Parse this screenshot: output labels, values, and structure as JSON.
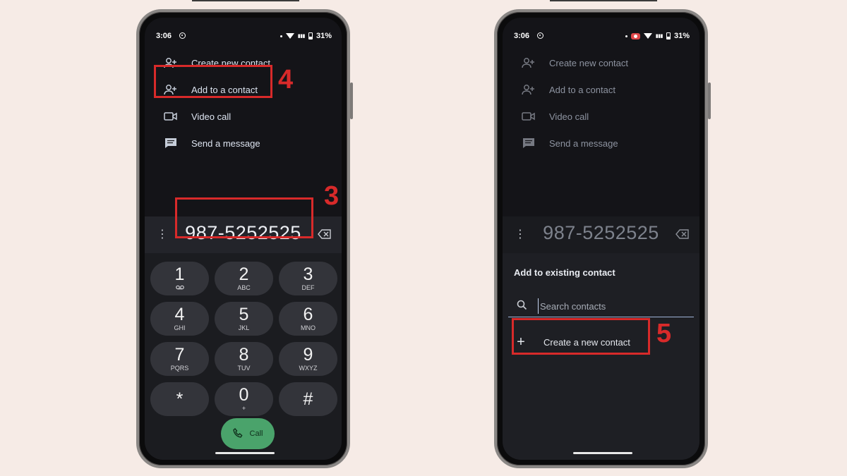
{
  "left_phone": {
    "status": {
      "time": "3:06",
      "battery": "31%"
    },
    "menu": [
      {
        "label": "Create new contact",
        "icon": "person-add-icon"
      },
      {
        "label": "Add to a contact",
        "icon": "person-add-icon"
      },
      {
        "label": "Video call",
        "icon": "video-icon"
      },
      {
        "label": "Send a message",
        "icon": "message-icon"
      }
    ],
    "dialed_number": "987-5252525",
    "keypad": [
      {
        "digit": "1",
        "letters": ""
      },
      {
        "digit": "2",
        "letters": "ABC"
      },
      {
        "digit": "3",
        "letters": "DEF"
      },
      {
        "digit": "4",
        "letters": "GHI"
      },
      {
        "digit": "5",
        "letters": "JKL"
      },
      {
        "digit": "6",
        "letters": "MNO"
      },
      {
        "digit": "7",
        "letters": "PQRS"
      },
      {
        "digit": "8",
        "letters": "TUV"
      },
      {
        "digit": "9",
        "letters": "WXYZ"
      },
      {
        "digit": "*",
        "letters": ""
      },
      {
        "digit": "0",
        "letters": "+"
      },
      {
        "digit": "#",
        "letters": ""
      }
    ],
    "call_label": "Call"
  },
  "right_phone": {
    "status": {
      "time": "3:06",
      "battery": "31%"
    },
    "menu": [
      {
        "label": "Create new contact"
      },
      {
        "label": "Add to a contact"
      },
      {
        "label": "Video call"
      },
      {
        "label": "Send a message"
      }
    ],
    "dialed_number": "987-5252525",
    "sheet": {
      "title": "Add to existing contact",
      "search_placeholder": "Search contacts",
      "create_label": "Create a new contact"
    }
  },
  "steps": {
    "three": "3",
    "four": "4",
    "five": "5"
  },
  "colors": {
    "highlight": "#d82a2a",
    "call_green": "#4aa36b",
    "background": "#f6ebe6"
  }
}
